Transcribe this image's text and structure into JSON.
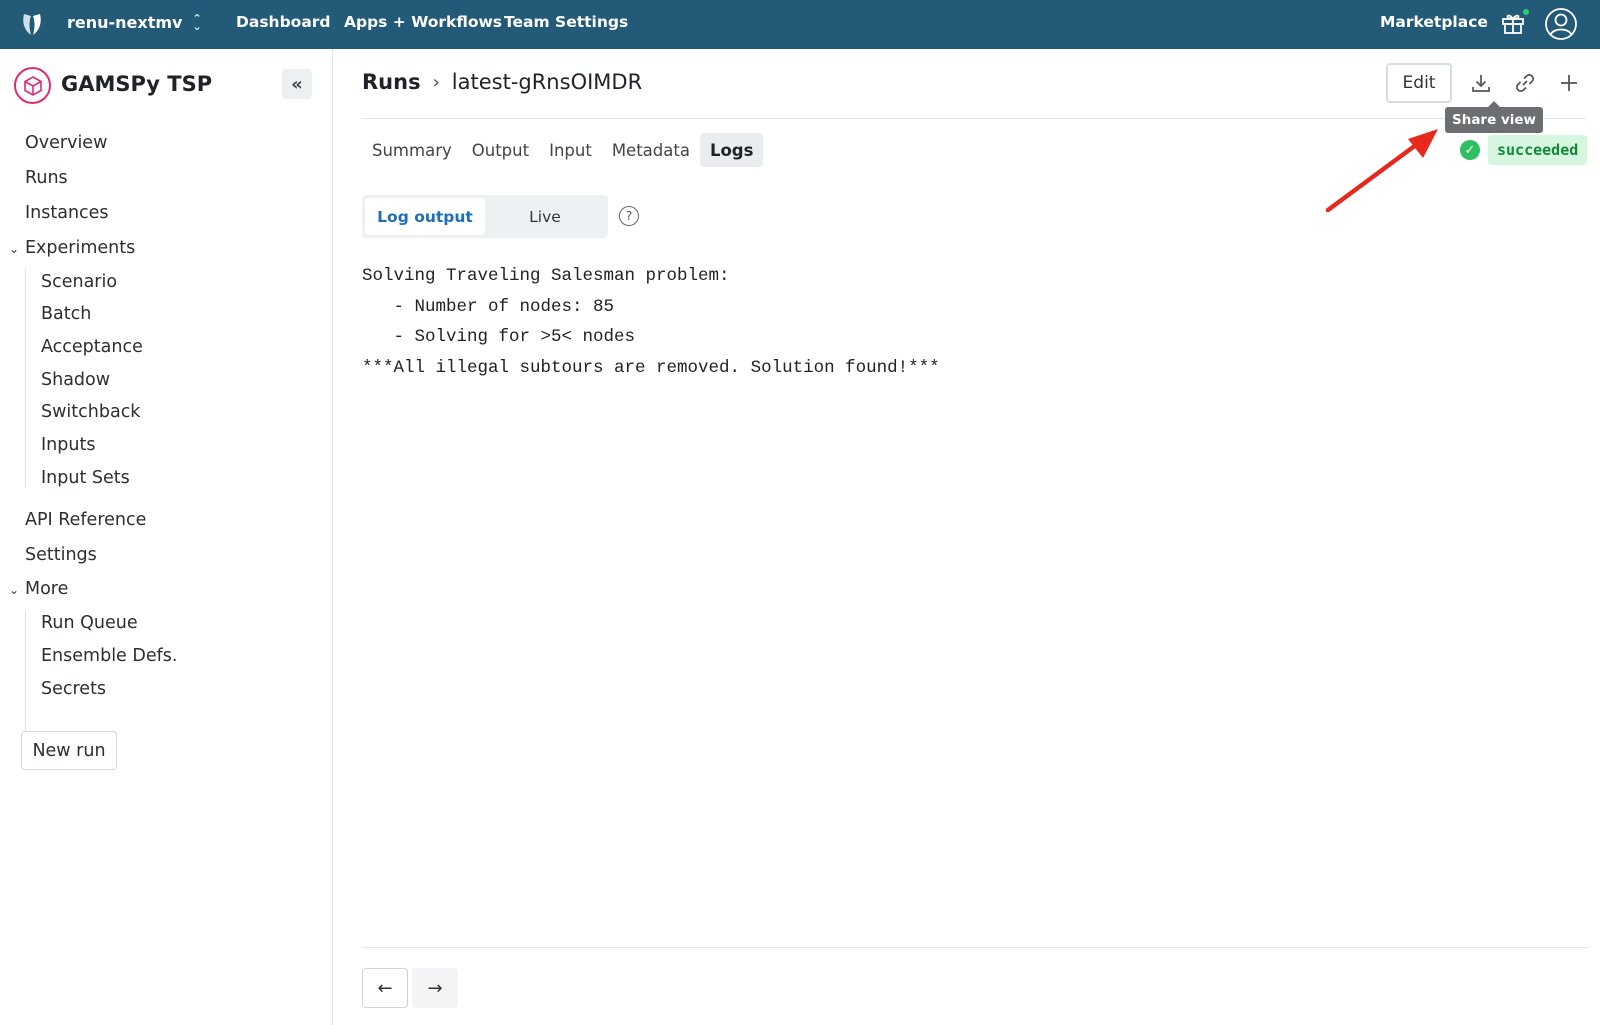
{
  "topnav": {
    "org_name": "renu-nextmv",
    "links": [
      "Dashboard",
      "Apps + Workflows",
      "Team Settings"
    ],
    "marketplace": "Marketplace",
    "icons": [
      "nextmv-logo-icon",
      "updown-chevron-icon",
      "gift-icon",
      "user-avatar-icon"
    ],
    "bg_color": "#235a78"
  },
  "sidebar": {
    "app_title": "GAMSPy TSP",
    "app_icon": "cube-icon",
    "collapse_icon": "double-chevron-left-icon",
    "items": {
      "overview": "Overview",
      "runs": "Runs",
      "instances": "Instances",
      "experiments": "Experiments",
      "experiments_sub": [
        "Scenario",
        "Batch",
        "Acceptance",
        "Shadow",
        "Switchback",
        "Inputs",
        "Input Sets"
      ],
      "api_reference": "API Reference",
      "settings": "Settings",
      "more": "More",
      "more_sub": [
        "Run Queue",
        "Ensemble Defs.",
        "Secrets"
      ]
    },
    "new_run": "New run"
  },
  "header": {
    "breadcrumb_root": "Runs",
    "breadcrumb_sep": "›",
    "run_name": "latest-gRnsOIMDR",
    "edit": "Edit",
    "action_icons": [
      "download-icon",
      "link-icon",
      "plus-icon"
    ],
    "tooltip": "Share view"
  },
  "tabs": [
    "Summary",
    "Output",
    "Input",
    "Metadata",
    "Logs"
  ],
  "active_tab": "Logs",
  "status": {
    "label": "succeeded",
    "color": "#2fbf63"
  },
  "log_view": {
    "options": [
      "Log output",
      "Live"
    ],
    "selected": "Log output",
    "lines": [
      "Solving Traveling Salesman problem:",
      "   - Number of nodes: 85",
      "   - Solving for >5< nodes",
      "***All illegal subtours are removed. Solution found!***"
    ]
  },
  "pager": {
    "prev_icon": "arrow-left-icon",
    "next_icon": "arrow-right-icon"
  },
  "annotation": {
    "color": "#e8281c"
  }
}
